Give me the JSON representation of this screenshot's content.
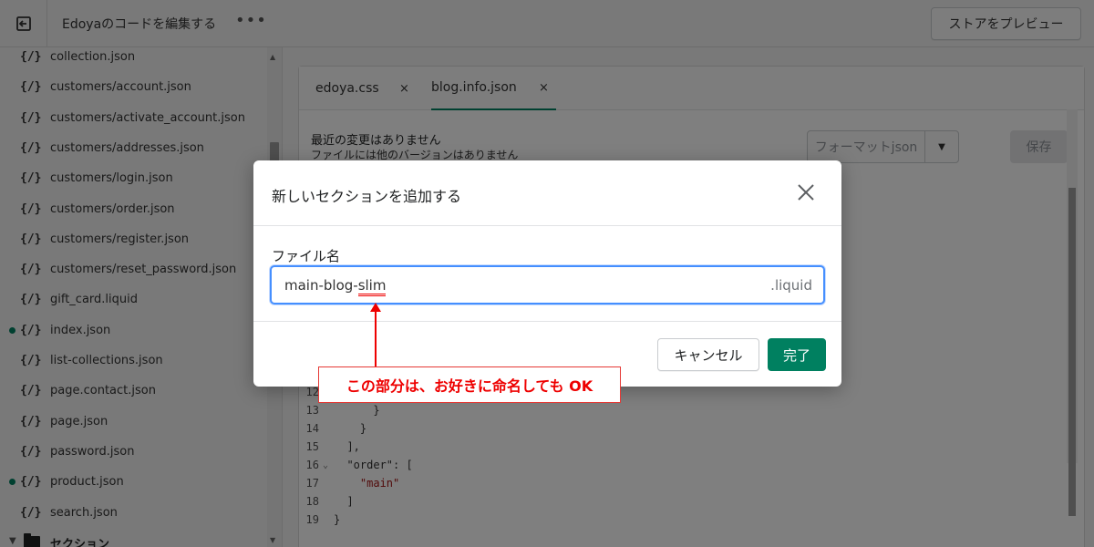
{
  "topbar": {
    "title": "Edoyaのコードを編集する",
    "more": "•••",
    "preview_label": "ストアをプレビュー"
  },
  "sidebar": {
    "files": [
      {
        "icon": "{/}",
        "name": "collection.json",
        "changed": false
      },
      {
        "icon": "{/}",
        "name": "customers/account.json",
        "changed": false
      },
      {
        "icon": "{/}",
        "name": "customers/activate_account.json",
        "changed": false
      },
      {
        "icon": "{/}",
        "name": "customers/addresses.json",
        "changed": false
      },
      {
        "icon": "{/}",
        "name": "customers/login.json",
        "changed": false
      },
      {
        "icon": "{/}",
        "name": "customers/order.json",
        "changed": false
      },
      {
        "icon": "{/}",
        "name": "customers/register.json",
        "changed": false
      },
      {
        "icon": "{/}",
        "name": "customers/reset_password.json",
        "changed": false
      },
      {
        "icon": "{/}",
        "name": "gift_card.liquid",
        "changed": false
      },
      {
        "icon": "{/}",
        "name": "index.json",
        "changed": true
      },
      {
        "icon": "{/}",
        "name": "list-collections.json",
        "changed": false
      },
      {
        "icon": "{/}",
        "name": "page.contact.json",
        "changed": false
      },
      {
        "icon": "{/}",
        "name": "page.json",
        "changed": false
      },
      {
        "icon": "{/}",
        "name": "password.json",
        "changed": false
      },
      {
        "icon": "{/}",
        "name": "product.json",
        "changed": true
      },
      {
        "icon": "{/}",
        "name": "search.json",
        "changed": false
      }
    ],
    "section_title": "セクション"
  },
  "editor": {
    "tabs": [
      {
        "label": "edoya.css",
        "close": "×"
      },
      {
        "label": "blog.info.json",
        "close": "×"
      }
    ],
    "status_line1": "最近の変更はありません",
    "status_line2": "ファイルには他のバージョンはありません",
    "format_label": "フォーマットjson",
    "save_label": "保存",
    "code_lines": [
      {
        "num": "12",
        "fold": "",
        "text": ""
      },
      {
        "num": "13",
        "fold": "",
        "text": "      }"
      },
      {
        "num": "14",
        "fold": "",
        "text": "    }"
      },
      {
        "num": "15",
        "fold": "",
        "text": "  ],"
      },
      {
        "num": "16",
        "fold": "⌄",
        "text": "  \"order\": ["
      },
      {
        "num": "17",
        "fold": "",
        "text": "    \"main\""
      },
      {
        "num": "18",
        "fold": "",
        "text": "  ]"
      },
      {
        "num": "19",
        "fold": "",
        "text": "}"
      }
    ]
  },
  "modal": {
    "title": "新しいセクションを追加する",
    "field_label": "ファイル名",
    "field_value_prefix": "main-blog-",
    "field_value_highlight": "slim",
    "field_suffix": ".liquid",
    "cancel_label": "キャンセル",
    "done_label": "完了"
  },
  "annotation": {
    "text": "この部分は、お好きに命名しても OK"
  },
  "colors": {
    "accent": "#008060",
    "focus": "#458fff",
    "annotation": "#e00000"
  }
}
